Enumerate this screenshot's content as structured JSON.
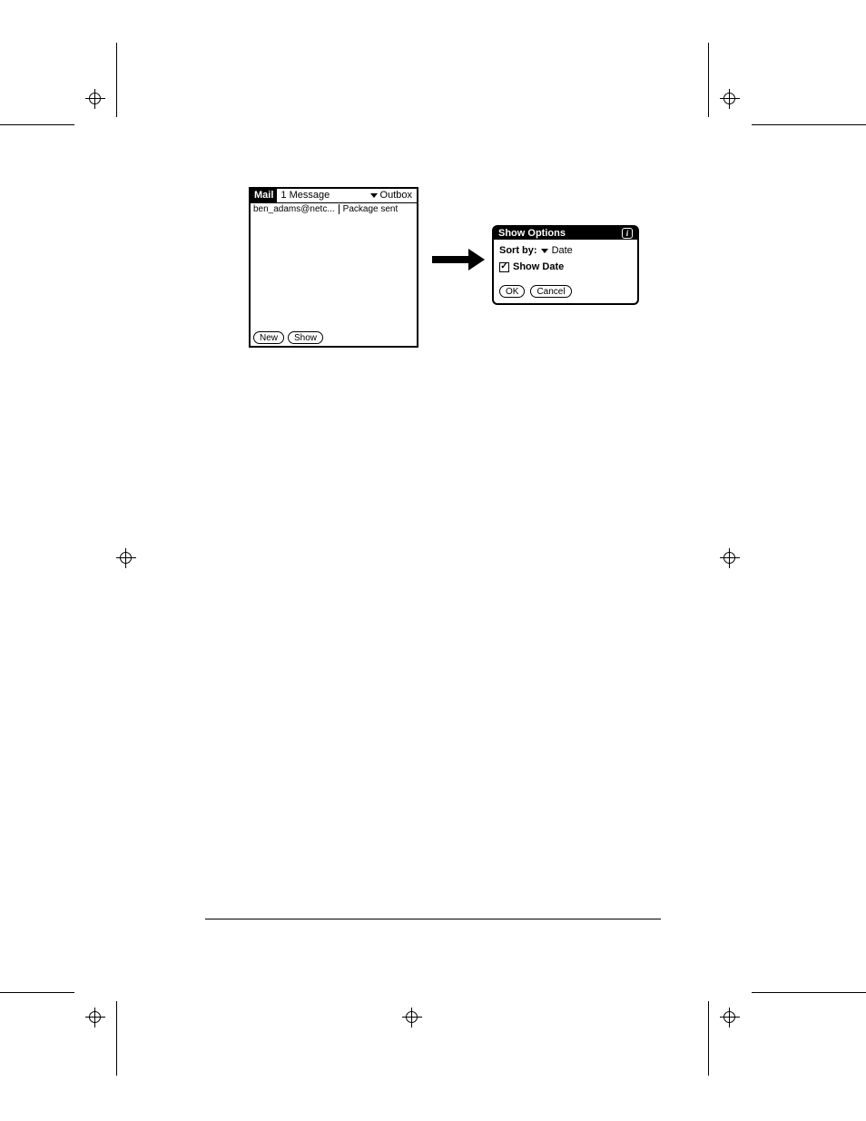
{
  "mail": {
    "app_label": "Mail",
    "count_label": "1 Message",
    "folder_label": "Outbox",
    "message": {
      "from": "ben_adams@netc...",
      "subject": "Package sent"
    },
    "buttons": {
      "new": "New",
      "show": "Show"
    }
  },
  "dialog": {
    "title": "Show Options",
    "info_glyph": "i",
    "sort_by_label": "Sort by:",
    "sort_by_value": "Date",
    "show_date_label": "Show Date",
    "show_date_check": "✓",
    "ok": "OK",
    "cancel": "Cancel"
  }
}
